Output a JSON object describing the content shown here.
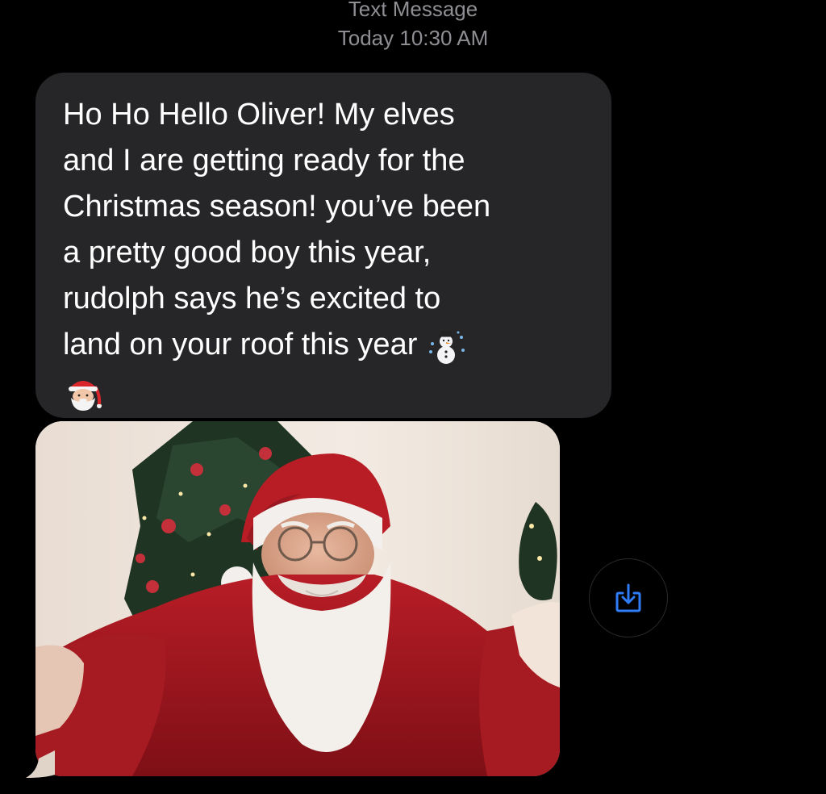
{
  "header": {
    "service": "Text Message",
    "timestamp": "Today 10:30 AM"
  },
  "message": {
    "lines": [
      "Ho Ho Hello Oliver! My elves",
      "and I are getting ready for the",
      "Christmas season! you’ve been",
      "a pretty good boy this year,",
      "rudolph says he’s excited to",
      "land on your roof this year"
    ],
    "emojis": [
      "snowman-icon",
      "santa-icon"
    ]
  },
  "attachment": {
    "type": "photo",
    "subject": "santa-selfie"
  },
  "share_button": {
    "icon": "save-download-icon",
    "color": "#2f7cf6"
  }
}
